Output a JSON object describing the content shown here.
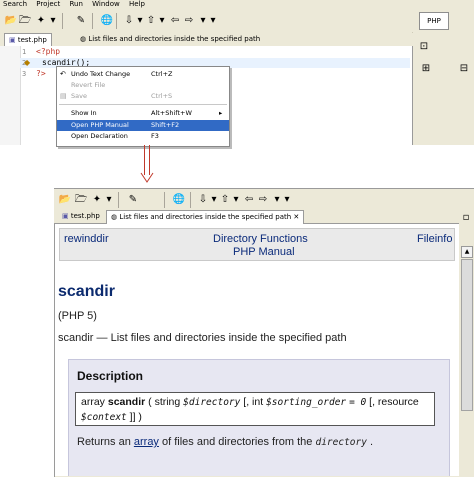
{
  "menubar": [
    "Search",
    "Project",
    "Run",
    "Window",
    "Help"
  ],
  "perspective_label": "PHP",
  "editor_tabs": [
    {
      "label": "test.php",
      "active": true
    },
    {
      "label": "List files and directories inside the specified path",
      "active": false
    }
  ],
  "line_numbers": [
    "1",
    "2",
    "3"
  ],
  "code_lines": [
    "<?php",
    "scandir();",
    "?>"
  ],
  "context_menu": [
    {
      "label": "Undo Text Change",
      "shortcut": "Ctrl+Z",
      "disabled": false,
      "selected": false
    },
    {
      "label": "Revert File",
      "shortcut": "",
      "disabled": true,
      "selected": false
    },
    {
      "label": "Save",
      "shortcut": "Ctrl+S",
      "disabled": true,
      "selected": false
    },
    {
      "label": "Show In",
      "shortcut": "Alt+Shift+W",
      "disabled": false,
      "selected": false,
      "submenu": true
    },
    {
      "label": "Open PHP Manual",
      "shortcut": "Shift+F2",
      "disabled": false,
      "selected": true
    },
    {
      "label": "Open Declaration",
      "shortcut": "F3",
      "disabled": false,
      "selected": false
    }
  ],
  "bottom_tabs": [
    {
      "label": "test.php",
      "active": false
    },
    {
      "label": "List files and directories inside the specified path",
      "active": true
    }
  ],
  "manual": {
    "prev_link": "rewinddir",
    "section_link": "Directory Functions",
    "manual_link": "PHP Manual",
    "next_link": "Fileinfo",
    "heading": "scandir",
    "version": "(PHP 5)",
    "purpose": "scandir — List files and directories inside the specified path",
    "description_heading": "Description",
    "synopsis": {
      "return_type": "array",
      "function": "scandir",
      "p1_type": "string",
      "p1_name": "$directory",
      "p2_type": "int",
      "p2_name": "$sorting_order",
      "p2_default": "= 0",
      "p3_type": "resource",
      "p3_name": "$context"
    },
    "returns_prefix": "Returns an",
    "returns_link": "array",
    "returns_mid": "of files and directories from the",
    "returns_param": "directory",
    "returns_suffix": "."
  },
  "colors": {
    "selection": "#316ac5",
    "arrow": "#c0392b",
    "manual_link": "#0a2a7a"
  }
}
